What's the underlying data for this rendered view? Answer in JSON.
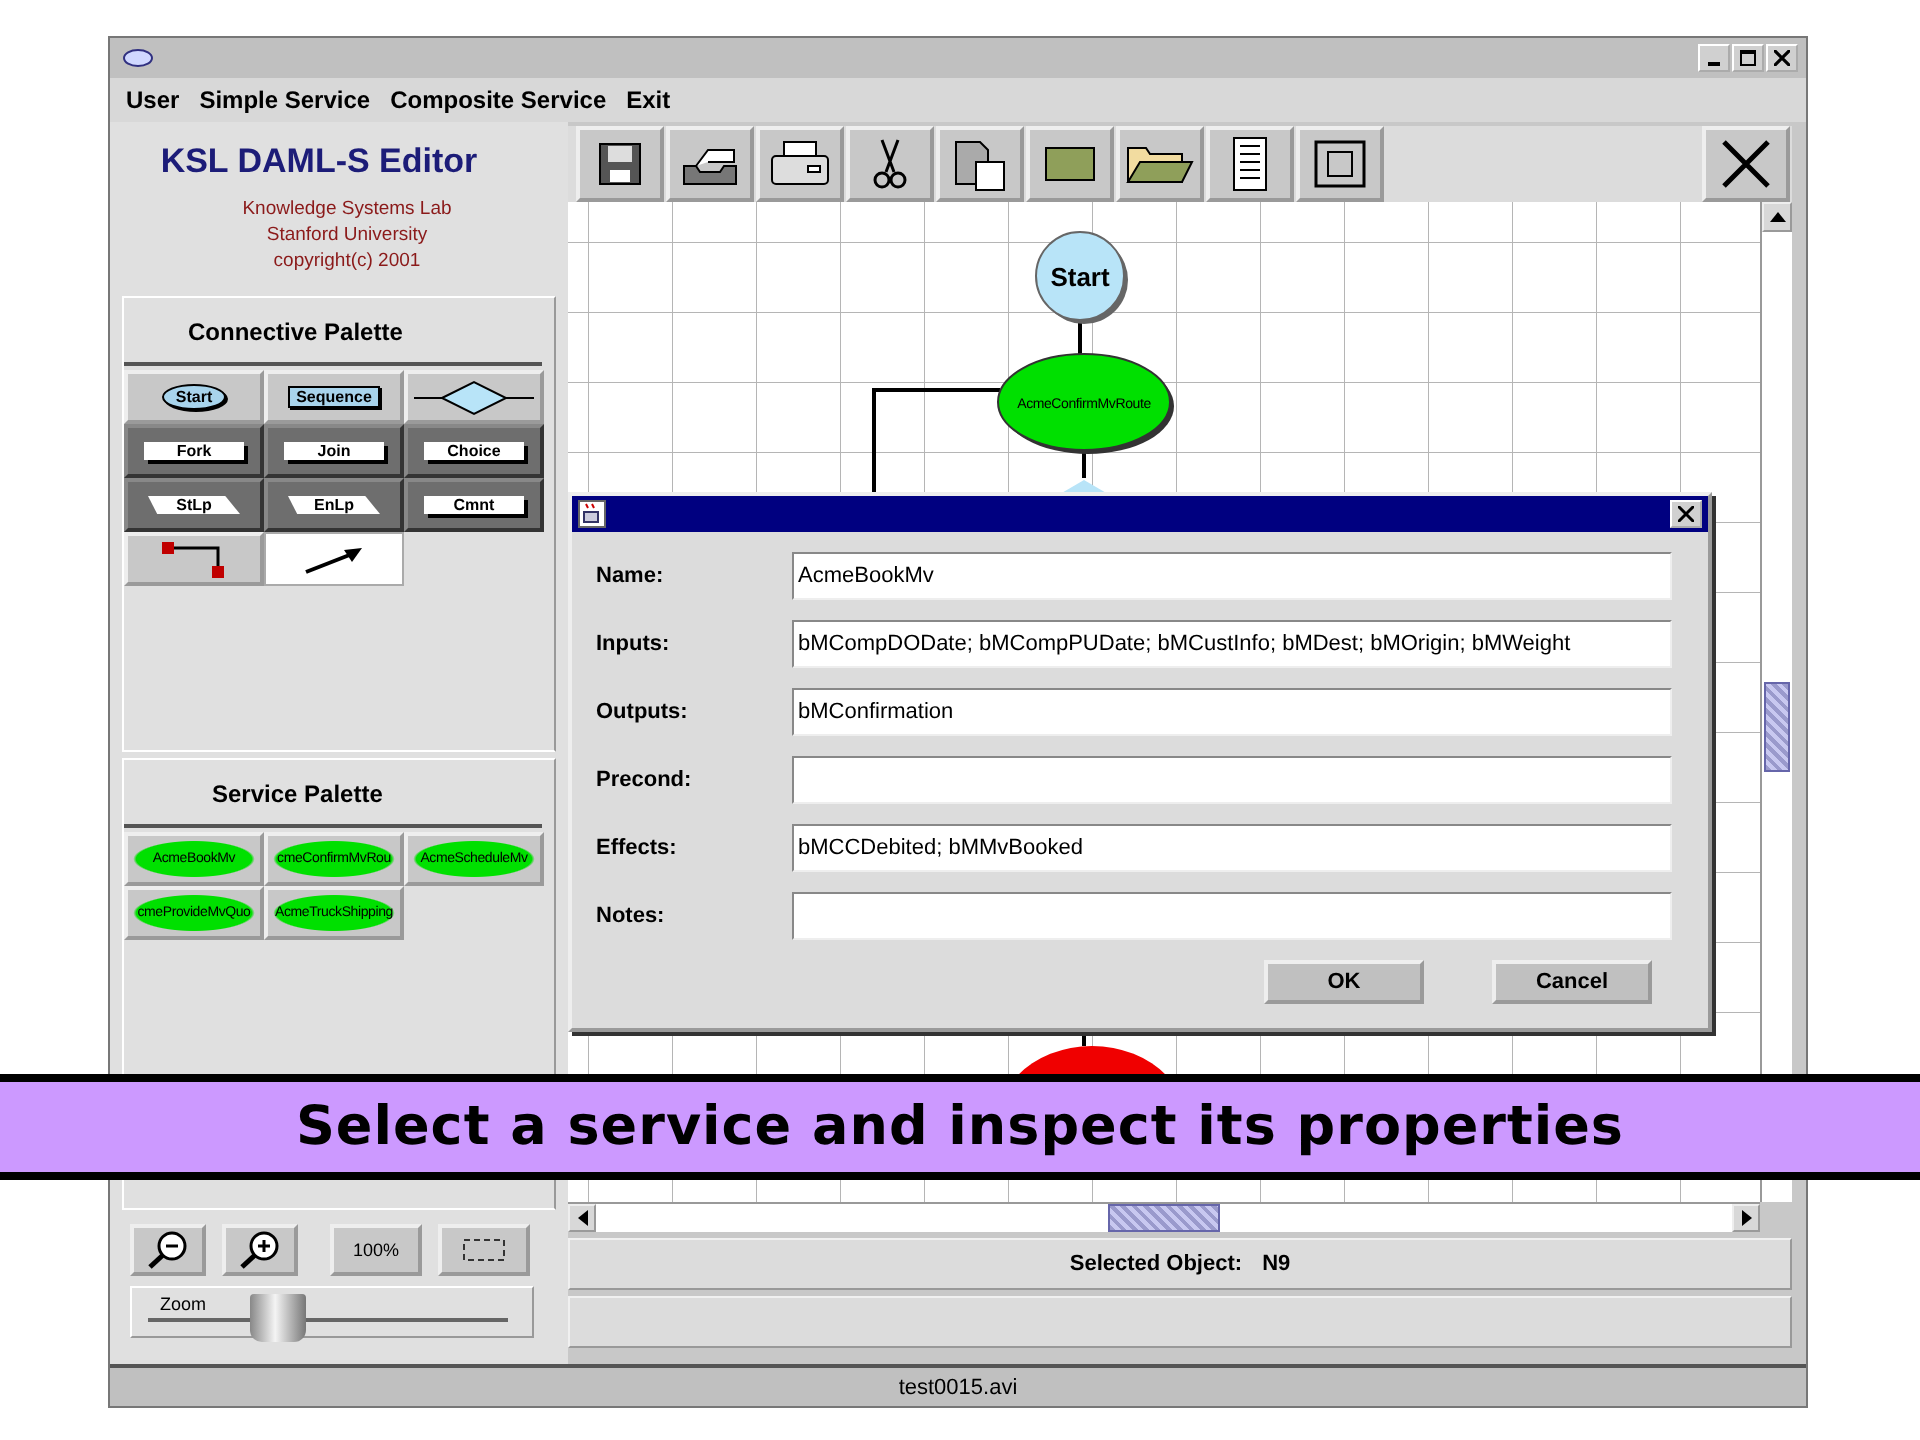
{
  "menu": [
    "User",
    "Simple Service",
    "Composite Service",
    "Exit"
  ],
  "app": {
    "title": "KSL DAML-S Editor",
    "credits": [
      "Knowledge Systems Lab",
      "Stanford University",
      "copyright(c) 2001"
    ]
  },
  "connective_palette": {
    "title": "Connective Palette",
    "items": [
      {
        "kind": "oval",
        "label": "Start",
        "selected": false
      },
      {
        "kind": "rect",
        "label": "Sequence",
        "selected": false
      },
      {
        "kind": "diamond",
        "selected": false
      },
      {
        "kind": "box",
        "label": "Fork",
        "selected": false
      },
      {
        "kind": "box",
        "label": "Join",
        "selected": false
      },
      {
        "kind": "box",
        "label": "Choice",
        "selected": false
      },
      {
        "kind": "parallelogram",
        "label": "StLp",
        "selected": false
      },
      {
        "kind": "parallelogram",
        "label": "EnLp",
        "selected": false
      },
      {
        "kind": "box",
        "label": "Cmnt",
        "selected": false
      },
      {
        "kind": "connector",
        "selected": false
      },
      {
        "kind": "arrow",
        "selected": true
      }
    ]
  },
  "service_palette": {
    "title": "Service Palette",
    "items": [
      "AcmeBookMv",
      "cmeConfirmMvRou",
      "AcmeScheduleMv",
      "cmeProvideMvQuo",
      "AcmeTruckShipping"
    ]
  },
  "zoom": {
    "percent_button": "100%",
    "label": "Zoom",
    "level": 0.36
  },
  "canvas": {
    "nodes": [
      {
        "kind": "start",
        "label": "Start"
      },
      {
        "kind": "service",
        "label": "AcmeConfirmMvRoute"
      },
      {
        "kind": "decision"
      },
      {
        "kind": "end"
      }
    ]
  },
  "status": {
    "label": "Selected Object:",
    "value": "N9"
  },
  "dialog": {
    "fields": [
      {
        "label": "Name:",
        "value": "AcmeBookMv"
      },
      {
        "label": "Inputs:",
        "value": "bMCompDODate; bMCompPUDate; bMCustInfo; bMDest; bMOrigin; bMWeight"
      },
      {
        "label": "Outputs:",
        "value": "bMConfirmation"
      },
      {
        "label": "Precond:"
      },
      {
        "label": "Effects:",
        "value": "bMCCDebited; bMMvBooked"
      },
      {
        "label": "Notes:"
      }
    ],
    "buttons": [
      "OK",
      "Cancel"
    ]
  },
  "caption": "Select a service and inspect its properties",
  "recorder_file": "test0015.avi"
}
